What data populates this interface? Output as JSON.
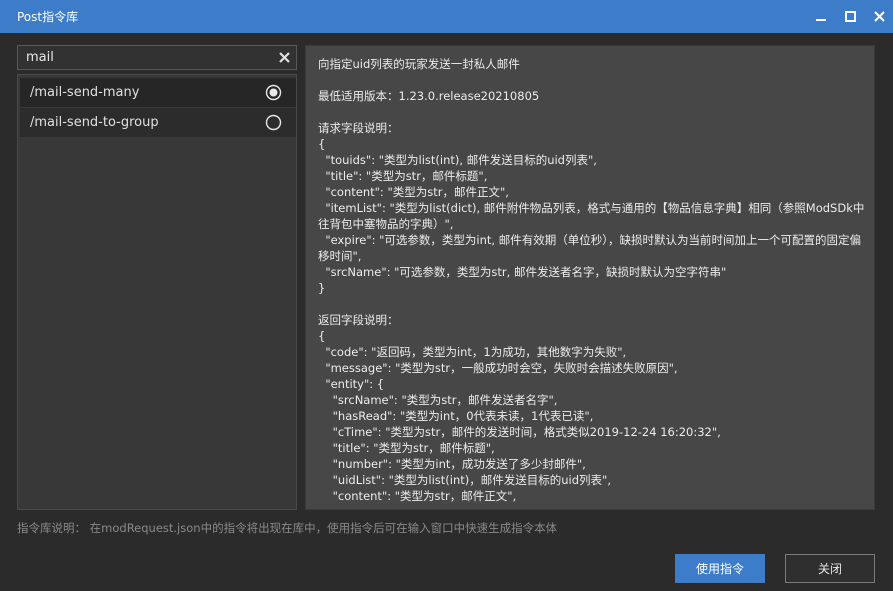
{
  "window": {
    "title": "Post指令库",
    "accent": "#3d7cc9"
  },
  "search": {
    "value": "mail",
    "clear_icon": "close-icon"
  },
  "commands": [
    {
      "label": "/mail-send-many",
      "selected": true
    },
    {
      "label": "/mail-send-to-group",
      "selected": false
    }
  ],
  "description": "向指定uid列表的玩家发送一封私人邮件\n\n最低适用版本：1.23.0.release20210805\n\n请求字段说明：\n{\n  \"touids\": \"类型为list(int), 邮件发送目标的uid列表\",\n  \"title\": \"类型为str，邮件标题\",\n  \"content\": \"类型为str，邮件正文\",\n  \"itemList\": \"类型为list(dict), 邮件附件物品列表，格式与通用的【物品信息字典】相同（参照ModSDk中往背包中塞物品的字典）\",\n  \"expire\": \"可选参数，类型为int, 邮件有效期（单位秒），缺损时默认为当前时间加上一个可配置的固定偏移时间\",\n  \"srcName\": \"可选参数，类型为str, 邮件发送者名字，缺损时默认为空字符串\"\n}\n\n返回字段说明：\n{\n  \"code\": \"返回码，类型为int，1为成功，其他数字为失败\",\n  \"message\": \"类型为str，一般成功时会空，失败时会描述失败原因\",\n  \"entity\": {\n    \"srcName\": \"类型为str，邮件发送者名字\",\n    \"hasRead\": \"类型为int，0代表未读，1代表已读\",\n    \"cTime\": \"类型为str，邮件的发送时间，格式类似2019-12-24 16:20:32\",\n    \"title\": \"类型为str，邮件标题\",\n    \"number\": \"类型为int，成功发送了多少封邮件\",\n    \"uidList\": \"类型为list(int)，邮件发送目标的uid列表\",\n    \"content\": \"类型为str，邮件正文\",",
  "footer": {
    "note": "指令库说明： 在modRequest.json中的指令将出现在库中，使用指令后可在输入窗口中快速生成指令本体"
  },
  "buttons": {
    "use": "使用指令",
    "close": "关闭"
  }
}
